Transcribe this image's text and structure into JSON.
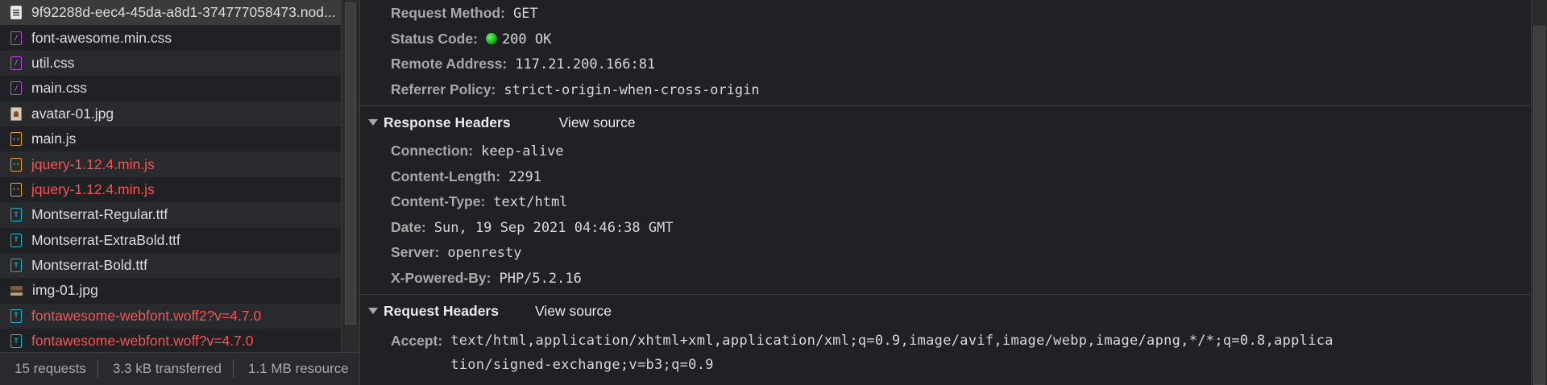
{
  "files": [
    {
      "name": "9f92288d-eec4-45da-a8d1-374777058473.nod...",
      "type": "doc",
      "icon": "document-icon",
      "error": false,
      "selected": true
    },
    {
      "name": "font-awesome.min.css",
      "type": "css",
      "icon": "stylesheet-icon",
      "error": false
    },
    {
      "name": "util.css",
      "type": "css",
      "icon": "stylesheet-icon",
      "error": false
    },
    {
      "name": "main.css",
      "type": "css",
      "icon": "stylesheet-icon",
      "error": false
    },
    {
      "name": "avatar-01.jpg",
      "type": "img",
      "icon": "image-icon",
      "error": false
    },
    {
      "name": "main.js",
      "type": "js",
      "icon": "script-icon",
      "error": false
    },
    {
      "name": "jquery-1.12.4.min.js",
      "type": "js",
      "icon": "script-icon",
      "error": true
    },
    {
      "name": "jquery-1.12.4.min.js",
      "type": "js",
      "icon": "script-icon",
      "error": true
    },
    {
      "name": "Montserrat-Regular.ttf",
      "type": "font",
      "icon": "font-icon",
      "error": false
    },
    {
      "name": "Montserrat-ExtraBold.ttf",
      "type": "font",
      "icon": "font-icon",
      "error": false
    },
    {
      "name": "Montserrat-Bold.ttf",
      "type": "font",
      "icon": "font-icon",
      "error": false
    },
    {
      "name": "img-01.jpg",
      "type": "photo",
      "icon": "image-icon",
      "error": false
    },
    {
      "name": "fontawesome-webfont.woff2?v=4.7.0",
      "type": "font",
      "icon": "font-icon",
      "error": true
    },
    {
      "name": "fontawesome-webfont.woff?v=4.7.0",
      "type": "font",
      "icon": "font-icon",
      "error": true
    }
  ],
  "summary": {
    "requests": "15 requests",
    "transferred": "3.3 kB transferred",
    "resources": "1.1 MB resource"
  },
  "general": [
    {
      "key": "Request Method:",
      "value": "GET"
    },
    {
      "key": "Status Code:",
      "value": "200 OK",
      "status_dot": true
    },
    {
      "key": "Remote Address:",
      "value": "117.21.200.166:81"
    },
    {
      "key": "Referrer Policy:",
      "value": "strict-origin-when-cross-origin"
    }
  ],
  "response_headers": {
    "title": "Response Headers",
    "view_source": "View source",
    "rows": [
      {
        "key": "Connection:",
        "value": "keep-alive"
      },
      {
        "key": "Content-Length:",
        "value": "2291"
      },
      {
        "key": "Content-Type:",
        "value": "text/html"
      },
      {
        "key": "Date:",
        "value": "Sun, 19 Sep 2021 04:46:38 GMT"
      },
      {
        "key": "Server:",
        "value": "openresty"
      },
      {
        "key": "X-Powered-By:",
        "value": "PHP/5.2.16"
      }
    ]
  },
  "request_headers": {
    "title": "Request Headers",
    "view_source": "View source",
    "rows": [
      {
        "key": "Accept:",
        "value": "text/html,application/xhtml+xml,application/xml;q=0.9,image/avif,image/webp,image/apng,*/*;q=0.8,application/signed-exchange;v=b3;q=0.9"
      }
    ]
  },
  "colors": {
    "error_text": "#f25555",
    "status_ok": "#16b316",
    "css_icon": "#b64fe0",
    "js_icon": "#e6a819",
    "font_icon": "#1fb3c9"
  }
}
